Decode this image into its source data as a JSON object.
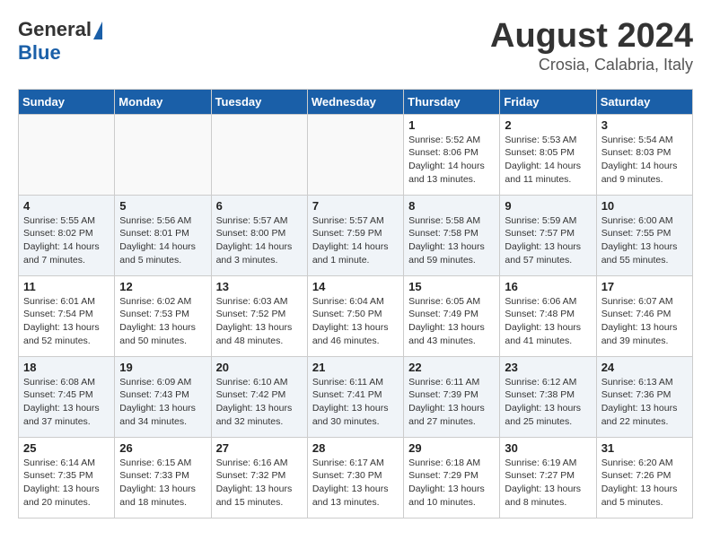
{
  "header": {
    "logo_general": "General",
    "logo_blue": "Blue",
    "title": "August 2024",
    "subtitle": "Crosia, Calabria, Italy"
  },
  "weekdays": [
    "Sunday",
    "Monday",
    "Tuesday",
    "Wednesday",
    "Thursday",
    "Friday",
    "Saturday"
  ],
  "weeks": [
    [
      {
        "day": "",
        "info": ""
      },
      {
        "day": "",
        "info": ""
      },
      {
        "day": "",
        "info": ""
      },
      {
        "day": "",
        "info": ""
      },
      {
        "day": "1",
        "info": "Sunrise: 5:52 AM\nSunset: 8:06 PM\nDaylight: 14 hours\nand 13 minutes."
      },
      {
        "day": "2",
        "info": "Sunrise: 5:53 AM\nSunset: 8:05 PM\nDaylight: 14 hours\nand 11 minutes."
      },
      {
        "day": "3",
        "info": "Sunrise: 5:54 AM\nSunset: 8:03 PM\nDaylight: 14 hours\nand 9 minutes."
      }
    ],
    [
      {
        "day": "4",
        "info": "Sunrise: 5:55 AM\nSunset: 8:02 PM\nDaylight: 14 hours\nand 7 minutes."
      },
      {
        "day": "5",
        "info": "Sunrise: 5:56 AM\nSunset: 8:01 PM\nDaylight: 14 hours\nand 5 minutes."
      },
      {
        "day": "6",
        "info": "Sunrise: 5:57 AM\nSunset: 8:00 PM\nDaylight: 14 hours\nand 3 minutes."
      },
      {
        "day": "7",
        "info": "Sunrise: 5:57 AM\nSunset: 7:59 PM\nDaylight: 14 hours\nand 1 minute."
      },
      {
        "day": "8",
        "info": "Sunrise: 5:58 AM\nSunset: 7:58 PM\nDaylight: 13 hours\nand 59 minutes."
      },
      {
        "day": "9",
        "info": "Sunrise: 5:59 AM\nSunset: 7:57 PM\nDaylight: 13 hours\nand 57 minutes."
      },
      {
        "day": "10",
        "info": "Sunrise: 6:00 AM\nSunset: 7:55 PM\nDaylight: 13 hours\nand 55 minutes."
      }
    ],
    [
      {
        "day": "11",
        "info": "Sunrise: 6:01 AM\nSunset: 7:54 PM\nDaylight: 13 hours\nand 52 minutes."
      },
      {
        "day": "12",
        "info": "Sunrise: 6:02 AM\nSunset: 7:53 PM\nDaylight: 13 hours\nand 50 minutes."
      },
      {
        "day": "13",
        "info": "Sunrise: 6:03 AM\nSunset: 7:52 PM\nDaylight: 13 hours\nand 48 minutes."
      },
      {
        "day": "14",
        "info": "Sunrise: 6:04 AM\nSunset: 7:50 PM\nDaylight: 13 hours\nand 46 minutes."
      },
      {
        "day": "15",
        "info": "Sunrise: 6:05 AM\nSunset: 7:49 PM\nDaylight: 13 hours\nand 43 minutes."
      },
      {
        "day": "16",
        "info": "Sunrise: 6:06 AM\nSunset: 7:48 PM\nDaylight: 13 hours\nand 41 minutes."
      },
      {
        "day": "17",
        "info": "Sunrise: 6:07 AM\nSunset: 7:46 PM\nDaylight: 13 hours\nand 39 minutes."
      }
    ],
    [
      {
        "day": "18",
        "info": "Sunrise: 6:08 AM\nSunset: 7:45 PM\nDaylight: 13 hours\nand 37 minutes."
      },
      {
        "day": "19",
        "info": "Sunrise: 6:09 AM\nSunset: 7:43 PM\nDaylight: 13 hours\nand 34 minutes."
      },
      {
        "day": "20",
        "info": "Sunrise: 6:10 AM\nSunset: 7:42 PM\nDaylight: 13 hours\nand 32 minutes."
      },
      {
        "day": "21",
        "info": "Sunrise: 6:11 AM\nSunset: 7:41 PM\nDaylight: 13 hours\nand 30 minutes."
      },
      {
        "day": "22",
        "info": "Sunrise: 6:11 AM\nSunset: 7:39 PM\nDaylight: 13 hours\nand 27 minutes."
      },
      {
        "day": "23",
        "info": "Sunrise: 6:12 AM\nSunset: 7:38 PM\nDaylight: 13 hours\nand 25 minutes."
      },
      {
        "day": "24",
        "info": "Sunrise: 6:13 AM\nSunset: 7:36 PM\nDaylight: 13 hours\nand 22 minutes."
      }
    ],
    [
      {
        "day": "25",
        "info": "Sunrise: 6:14 AM\nSunset: 7:35 PM\nDaylight: 13 hours\nand 20 minutes."
      },
      {
        "day": "26",
        "info": "Sunrise: 6:15 AM\nSunset: 7:33 PM\nDaylight: 13 hours\nand 18 minutes."
      },
      {
        "day": "27",
        "info": "Sunrise: 6:16 AM\nSunset: 7:32 PM\nDaylight: 13 hours\nand 15 minutes."
      },
      {
        "day": "28",
        "info": "Sunrise: 6:17 AM\nSunset: 7:30 PM\nDaylight: 13 hours\nand 13 minutes."
      },
      {
        "day": "29",
        "info": "Sunrise: 6:18 AM\nSunset: 7:29 PM\nDaylight: 13 hours\nand 10 minutes."
      },
      {
        "day": "30",
        "info": "Sunrise: 6:19 AM\nSunset: 7:27 PM\nDaylight: 13 hours\nand 8 minutes."
      },
      {
        "day": "31",
        "info": "Sunrise: 6:20 AM\nSunset: 7:26 PM\nDaylight: 13 hours\nand 5 minutes."
      }
    ]
  ]
}
